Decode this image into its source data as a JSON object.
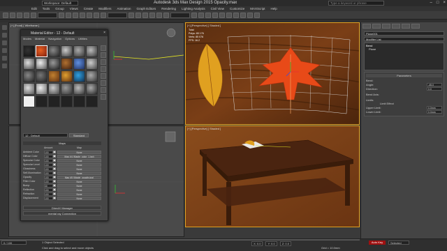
{
  "window": {
    "title": "Autodesk 3ds Max Design 2015     Opacity.max",
    "workspace": "Workspace: Default",
    "search_placeholder": "Type a keyword or phrase",
    "controls": [
      "–",
      "□",
      "×"
    ]
  },
  "menu": {
    "items": [
      "Edit",
      "Tools",
      "Group",
      "Views",
      "Create",
      "Modifiers",
      "Animation",
      "Graph Editors",
      "Rendering",
      "Lighting Analysis",
      "Civil View",
      "Customize",
      "MAXScript",
      "Help"
    ]
  },
  "viewports": {
    "top_left_label": "[+] [Front] [ Wireframe ]",
    "top_right_label": "[+] [Perspective] [ Shaded ]",
    "top_right_stats": [
      "Total",
      "Polys:  85 176",
      "Verts:  85 076",
      "FPS:    16.2"
    ],
    "bottom_right_label": "[+] [Perspective] [ Shaded ]"
  },
  "material_editor": {
    "title": "Material Editor - 12 - Default",
    "menu": [
      "Modes",
      "Material",
      "Navigation",
      "Options",
      "Utilities"
    ],
    "material_name": "12 - Default",
    "material_type": "Standard",
    "maps_header": "Maps",
    "amount_header": "Amount",
    "map_header": "Map",
    "maps": [
      {
        "label": "Ambient Color",
        "amount": "100",
        "map": "None"
      },
      {
        "label": "Diffuse Color",
        "amount": "100",
        "map": "Map #4 (Maple_color_1.jpg)"
      },
      {
        "label": "Specular Color",
        "amount": "100",
        "map": "None"
      },
      {
        "label": "Specular Level",
        "amount": "100",
        "map": "None"
      },
      {
        "label": "Glossiness",
        "amount": "100",
        "map": "None"
      },
      {
        "label": "Self-Illumination",
        "amount": "100",
        "map": "None"
      },
      {
        "label": "Opacity",
        "amount": "100",
        "map": "Map #5 (Maple_opacity.jpg)"
      },
      {
        "label": "Filter Color",
        "amount": "100",
        "map": "None"
      },
      {
        "label": "Bump",
        "amount": "30",
        "map": "None"
      },
      {
        "label": "Reflection",
        "amount": "100",
        "map": "None"
      },
      {
        "label": "Refraction",
        "amount": "100",
        "map": "None"
      },
      {
        "label": "Displacement",
        "amount": "100",
        "map": "None"
      }
    ],
    "rollouts": [
      "DirectX Manager",
      "mental ray Connection"
    ]
  },
  "command_panel": {
    "object_name": "Plane001",
    "modifier_list": "Modifier List",
    "stack": [
      "Bend",
      "Plane"
    ],
    "parameters_title": "Parameters",
    "bend_label": "Bend:",
    "angle_label": "Angle:",
    "angle_value": "-45.0",
    "direction_label": "Direction:",
    "direction_value": "0.0",
    "axis_label": "Bend Axis:",
    "limits_label": "Limits",
    "limit_effect": "Limit Effect",
    "upper_label": "Upper Limit:",
    "upper_value": "0.0mm",
    "lower_label": "Lower Limit:",
    "lower_value": "0.0mm"
  },
  "status": {
    "frame": "0 / 100",
    "line1": "1 Object Selected",
    "line2": "Click and drag to select and move objects",
    "x": "X: 0.0",
    "y": "Y: 0.0",
    "z": "Z: 0.0",
    "grid": "Grid = 10.0mm",
    "autokey": "Auto Key",
    "selected": "Selected"
  }
}
